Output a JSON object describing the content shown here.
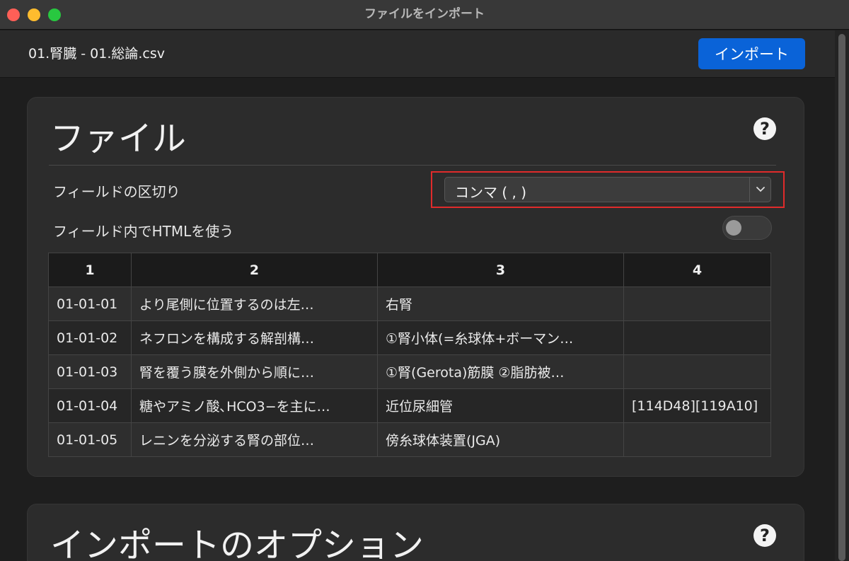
{
  "window": {
    "title": "ファイルをインポート"
  },
  "header": {
    "file_name": "01.腎臓 - 01.総論.csv",
    "import_label": "インポート"
  },
  "file_section": {
    "title": "ファイル",
    "help_label": "?",
    "separator_label": "フィールドの区切り",
    "separator_value": "コンマ ( , )",
    "html_label": "フィールド内でHTMLを使う",
    "html_enabled": false
  },
  "table": {
    "headers": [
      "1",
      "2",
      "3",
      "4"
    ],
    "rows": [
      [
        "01-01-01",
        "より尾側に位置するのは左…",
        "右腎",
        ""
      ],
      [
        "01-01-02",
        "ネフロンを構成する解剖構…",
        "①腎小体(=糸球体+ボーマン…",
        ""
      ],
      [
        "01-01-03",
        "腎を覆う膜を外側から順に…",
        "①腎(Gerota)筋膜 ②脂肪被…",
        ""
      ],
      [
        "01-01-04",
        "糖やアミノ酸､HCO3−を主に…",
        "近位尿細管",
        "[114D48][119A10]"
      ],
      [
        "01-01-05",
        "レニンを分泌する腎の部位…",
        "傍糸球体装置(JGA)",
        ""
      ]
    ]
  },
  "options_section": {
    "title": "インポートのオプション",
    "help_label": "?"
  },
  "icons": {
    "select_arrow": "chevron-down-icon",
    "help": "question-circle-icon"
  },
  "colors": {
    "accent": "#0a63d8",
    "highlight": "#e02b2b"
  }
}
